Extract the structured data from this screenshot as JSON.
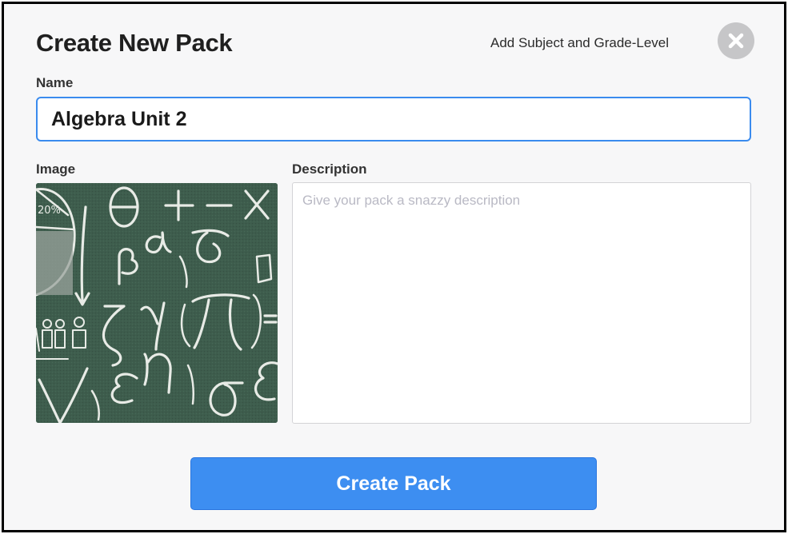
{
  "dialog": {
    "title": "Create New Pack",
    "subject_link": "Add Subject and Grade-Level",
    "close_icon": "close-icon"
  },
  "name_field": {
    "label": "Name",
    "value": "Algebra Unit 2"
  },
  "image_field": {
    "label": "Image",
    "image_description_icon": "chalkboard-math-symbols-image"
  },
  "description_field": {
    "label": "Description",
    "placeholder": "Give your pack a snazzy description",
    "value": ""
  },
  "create_button": {
    "label": "Create Pack"
  },
  "colors": {
    "accent": "#3d8ef1",
    "input_focus_border": "#3a8bee",
    "close_button_bg": "#c6c6c8",
    "chalkboard": "#3d5c4c"
  }
}
